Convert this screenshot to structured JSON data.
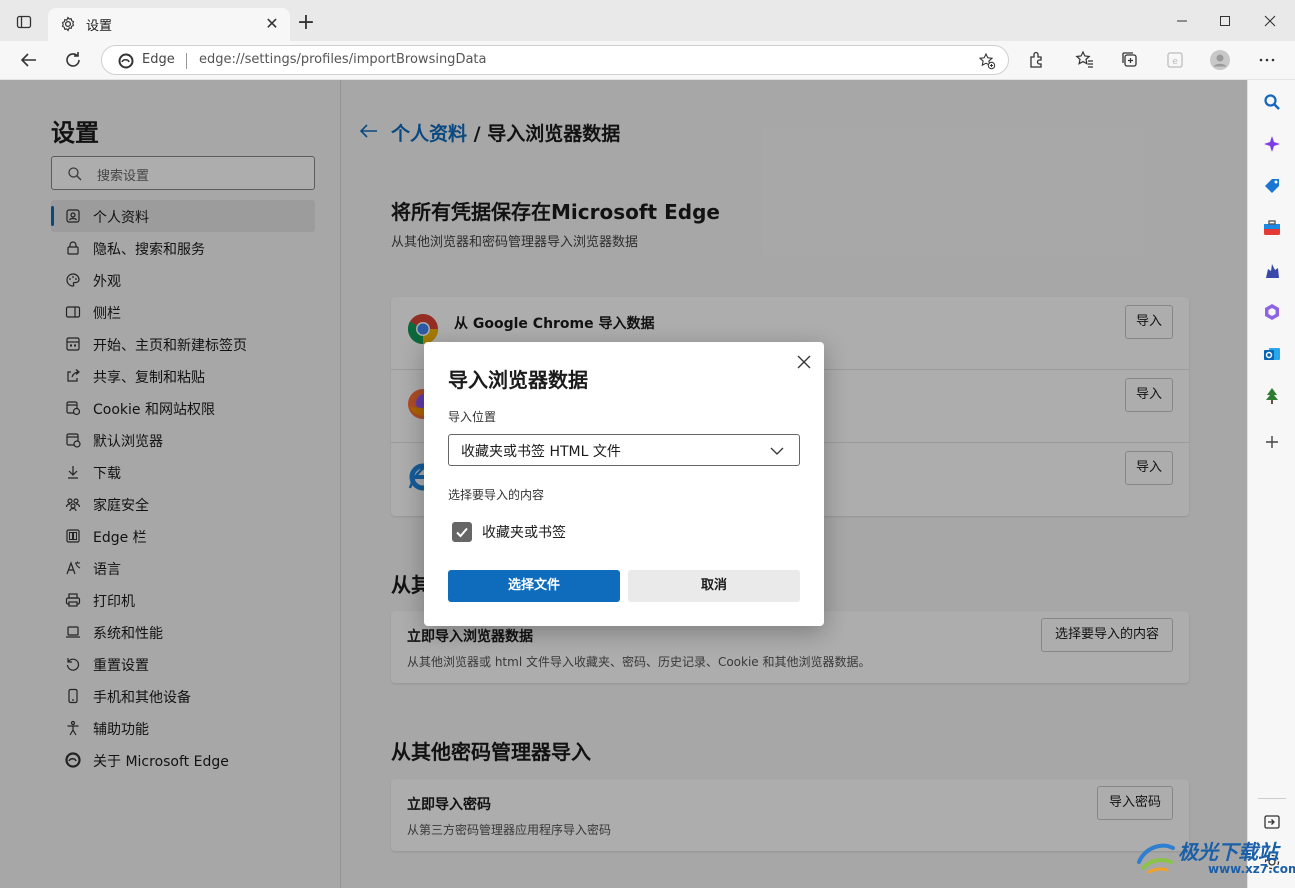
{
  "tab": {
    "title": "设置"
  },
  "address": {
    "label": "Edge",
    "url": "edge://settings/profiles/importBrowsingData"
  },
  "settings": {
    "title": "设置",
    "search_placeholder": "搜索设置",
    "nav": [
      {
        "label": "个人资料",
        "icon": "profile-icon"
      },
      {
        "label": "隐私、搜索和服务",
        "icon": "lock-icon"
      },
      {
        "label": "外观",
        "icon": "palette-icon"
      },
      {
        "label": "侧栏",
        "icon": "sidebar-icon"
      },
      {
        "label": "开始、主页和新建标签页",
        "icon": "home-icon"
      },
      {
        "label": "共享、复制和粘贴",
        "icon": "share-icon"
      },
      {
        "label": "Cookie 和网站权限",
        "icon": "cookie-icon"
      },
      {
        "label": "默认浏览器",
        "icon": "browser-icon"
      },
      {
        "label": "下载",
        "icon": "download-icon"
      },
      {
        "label": "家庭安全",
        "icon": "family-icon"
      },
      {
        "label": "Edge 栏",
        "icon": "edge-bar-icon"
      },
      {
        "label": "语言",
        "icon": "language-icon"
      },
      {
        "label": "打印机",
        "icon": "printer-icon"
      },
      {
        "label": "系统和性能",
        "icon": "laptop-icon"
      },
      {
        "label": "重置设置",
        "icon": "reset-icon"
      },
      {
        "label": "手机和其他设备",
        "icon": "phone-icon"
      },
      {
        "label": "辅助功能",
        "icon": "accessibility-icon"
      },
      {
        "label": "关于 Microsoft Edge",
        "icon": "edge-icon"
      }
    ]
  },
  "main": {
    "breadcrumb_link": "个人资料",
    "breadcrumb_sep": " / ",
    "breadcrumb_current": "导入浏览器数据",
    "section1_title": "将所有凭据保存在Microsoft Edge",
    "section1_sub": "从其他浏览器和密码管理器导入浏览器数据",
    "import_rows": [
      {
        "title": "从 Google Chrome 导入数据",
        "button": "导入"
      },
      {
        "title": "",
        "button": "导入"
      },
      {
        "title": "",
        "button": "导入"
      }
    ],
    "section2_title_partial": "从其",
    "card2_title": "立即导入浏览器数据",
    "card2_desc": "从其他浏览器或 html 文件导入收藏夹、密码、历史记录、Cookie 和其他浏览器数据。",
    "card2_button": "选择要导入的内容",
    "section3_title": "从其他密码管理器导入",
    "card3_title": "立即导入密码",
    "card3_desc": "从第三方密码管理器应用程序导入密码",
    "card3_button": "导入密码"
  },
  "dialog": {
    "title": "导入浏览器数据",
    "location_label": "导入位置",
    "location_value": "收藏夹或书签 HTML 文件",
    "content_label": "选择要导入的内容",
    "checkbox_label": "收藏夹或书签",
    "checkbox_checked": true,
    "ok_label": "选择文件",
    "cancel_label": "取消"
  },
  "watermark": {
    "text": "极光下载站",
    "url": "www.xz7.com"
  },
  "colors": {
    "accent": "#0f6cbd",
    "overlay": "rgba(0,0,0,0.32)"
  }
}
